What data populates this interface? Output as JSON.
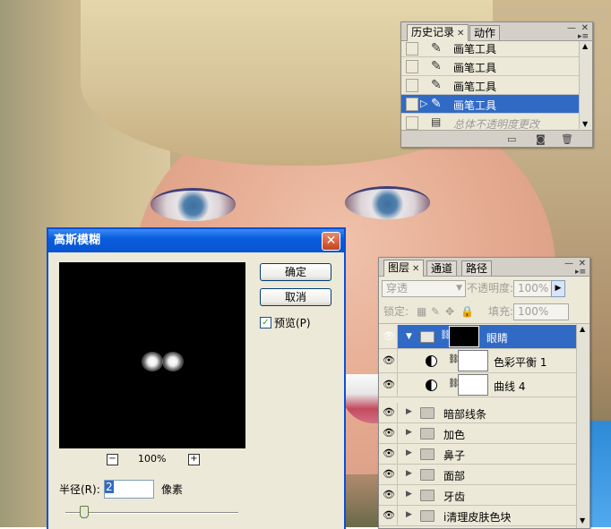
{
  "history": {
    "tabs": [
      {
        "label": "历史记录",
        "active": true
      },
      {
        "label": "动作",
        "active": false
      }
    ],
    "items": [
      {
        "label": "画笔工具",
        "selected": false
      },
      {
        "label": "画笔工具",
        "selected": false
      },
      {
        "label": "画笔工具",
        "selected": false
      },
      {
        "label": "画笔工具",
        "selected": true
      },
      {
        "label": "总体不透明度更改",
        "selected": false,
        "dimmed": true
      }
    ],
    "bottom_icons": [
      "new-document-icon",
      "camera-icon",
      "trash-icon"
    ]
  },
  "dialog": {
    "title": "高斯模糊",
    "ok_label": "确定",
    "cancel_label": "取消",
    "preview_label": "预览(P)",
    "preview_checked": true,
    "zoom": "100%",
    "zoom_out": "−",
    "zoom_in": "+",
    "radius_label": "半径(R):",
    "radius_value": "2",
    "unit": "像素",
    "slider_value": 2
  },
  "layers": {
    "tabs": [
      {
        "label": "图层",
        "active": true
      },
      {
        "label": "通道",
        "active": false
      },
      {
        "label": "路径",
        "active": false
      }
    ],
    "blend_mode": "穿透",
    "opacity_label": "不透明度:",
    "opacity_value": "100%",
    "lock_label": "锁定:",
    "fill_label": "填充:",
    "fill_value": "100%",
    "rows": [
      {
        "name": "眼睛",
        "kind": "group-mask",
        "selected": true,
        "expanded": true
      },
      {
        "name": "色彩平衡 1",
        "kind": "adjustment"
      },
      {
        "name": "曲线 4",
        "kind": "adjustment"
      },
      {
        "name": "暗部线条",
        "kind": "group"
      },
      {
        "name": "加色",
        "kind": "group"
      },
      {
        "name": "鼻子",
        "kind": "group"
      },
      {
        "name": "面部",
        "kind": "group"
      },
      {
        "name": "牙齿",
        "kind": "group"
      },
      {
        "name": "i清理皮肤色块",
        "kind": "group"
      }
    ]
  }
}
